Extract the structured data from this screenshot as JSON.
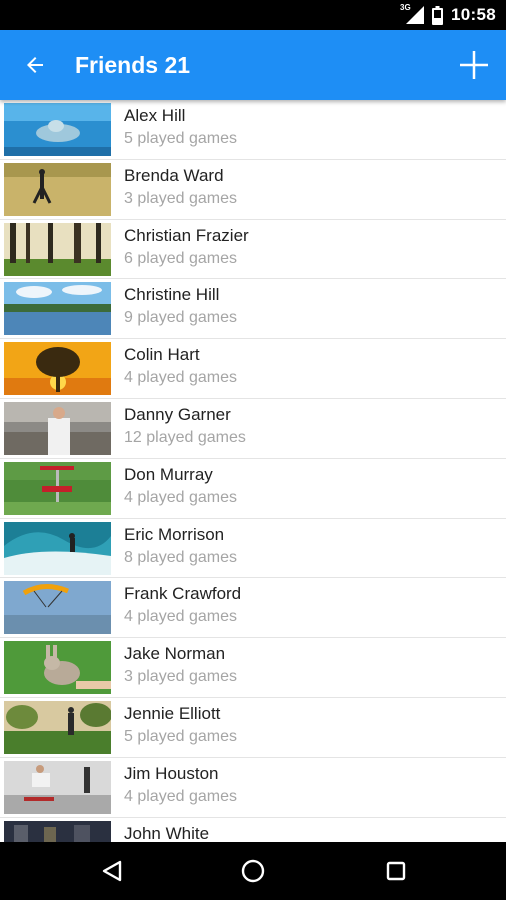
{
  "status_bar": {
    "time": "10:58",
    "network": "3G"
  },
  "app_bar": {
    "title": "Friends 21",
    "background": "#1e8ef5"
  },
  "friends": [
    {
      "name": "Alex Hill",
      "games": "5 played games"
    },
    {
      "name": "Brenda Ward",
      "games": "3 played games"
    },
    {
      "name": "Christian Frazier",
      "games": "6 played games"
    },
    {
      "name": "Christine Hill",
      "games": "9 played games"
    },
    {
      "name": "Colin Hart",
      "games": "4 played games"
    },
    {
      "name": "Danny Garner",
      "games": "12 played games"
    },
    {
      "name": "Don Murray",
      "games": "4 played games"
    },
    {
      "name": "Eric Morrison",
      "games": "8 played games"
    },
    {
      "name": "Frank Crawford",
      "games": "4 played games"
    },
    {
      "name": "Jake Norman",
      "games": "3 played games"
    },
    {
      "name": "Jennie Elliott",
      "games": "5 played games"
    },
    {
      "name": "Jim Houston",
      "games": "4 played games"
    },
    {
      "name": "John White",
      "games": ""
    }
  ],
  "icons": {
    "back": "arrow-left-icon",
    "add": "plus-icon",
    "nav_back": "triangle-back-icon",
    "nav_home": "circle-home-icon",
    "nav_recents": "square-recents-icon"
  }
}
